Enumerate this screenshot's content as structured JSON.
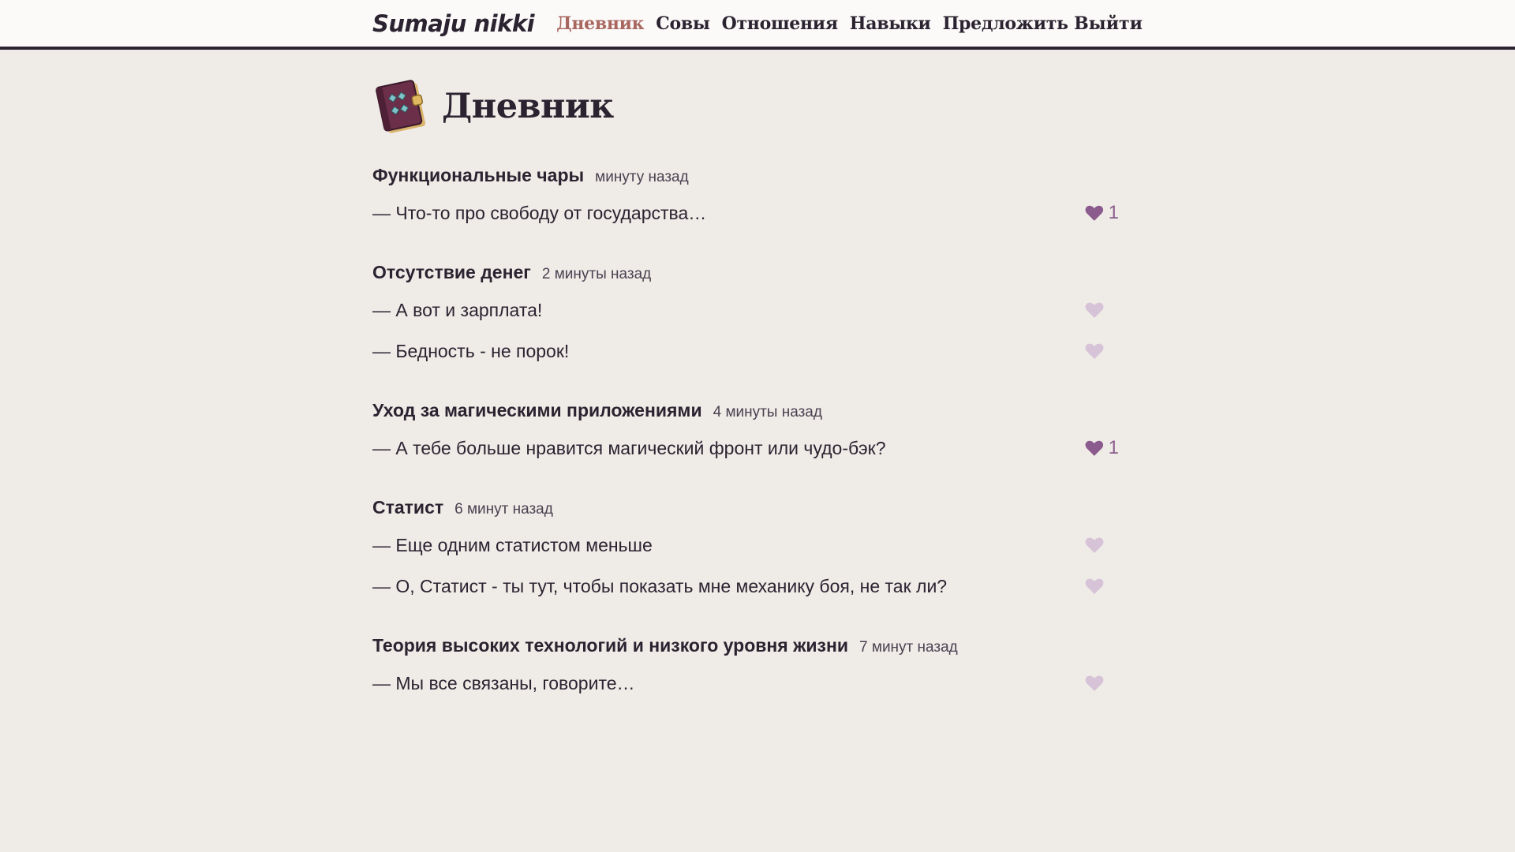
{
  "header": {
    "logo": "Sumaju nikki",
    "nav": [
      {
        "label": "Дневник",
        "active": true
      },
      {
        "label": "Совы",
        "active": false
      },
      {
        "label": "Отношения",
        "active": false
      },
      {
        "label": "Навыки",
        "active": false
      },
      {
        "label": "Предложить",
        "active": false
      }
    ],
    "logout": "Выйти"
  },
  "page": {
    "title": "Дневник",
    "icon": "diary-book-icon"
  },
  "colors": {
    "accent": "#a8665f",
    "heart_active": "#8a5b8c",
    "heart_inactive": "#d6c3d8",
    "background": "#efebe7"
  },
  "topics": [
    {
      "title": "Функциональные чары",
      "time": "минуту назад",
      "posts": [
        {
          "text": "— Что-то про свободу от государства…",
          "likes": "1",
          "liked": true
        }
      ]
    },
    {
      "title": "Отсутствие денег",
      "time": "2 минуты назад",
      "posts": [
        {
          "text": "— А вот и зарплата!",
          "likes": "",
          "liked": false
        },
        {
          "text": "— Бедность - не порок!",
          "likes": "",
          "liked": false
        }
      ]
    },
    {
      "title": "Уход за магическими приложениями",
      "time": "4 минуты назад",
      "posts": [
        {
          "text": "— А тебе больше нравится магический фронт или чудо-бэк?",
          "likes": "1",
          "liked": true
        }
      ]
    },
    {
      "title": "Статист",
      "time": "6 минут назад",
      "posts": [
        {
          "text": "— Еще одним статистом меньше",
          "likes": "",
          "liked": false
        },
        {
          "text": "— О, Статист - ты тут, чтобы показать мне механику боя, не так ли?",
          "likes": "",
          "liked": false
        }
      ]
    },
    {
      "title": "Теория высоких технологий и низкого уровня жизни",
      "time": "7 минут назад",
      "posts": [
        {
          "text": "— Мы все связаны, говорите…",
          "likes": "",
          "liked": false
        }
      ]
    }
  ]
}
